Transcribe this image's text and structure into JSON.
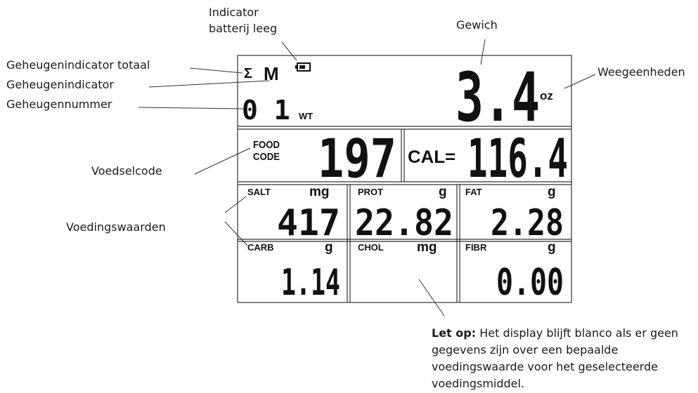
{
  "callouts": {
    "battery_indicator_line1": "Indicator",
    "battery_indicator_line2": "batterij leeg",
    "weight": "Gewich",
    "memory_total": "Geheugenindicator totaal",
    "memory_indicator": "Geheugenindicator",
    "memory_number": "Geheugennummer",
    "weight_units": "Weegeenheden",
    "food_code": "Voedselcode",
    "nutrition_values": "Voedingswaarden"
  },
  "display": {
    "sigma": "Σ",
    "memory_symbol": "M",
    "memory_number": "0 1",
    "wt_label": "WT",
    "weight_value": "3.4",
    "weight_unit": "oz",
    "food_label_line1": "FOOD",
    "food_label_line2": "CODE",
    "food_code_value": "197",
    "cal_label": "CAL=",
    "cal_value": "116.4",
    "cells": [
      {
        "name": "SALT",
        "unit": "mg",
        "value": "417"
      },
      {
        "name": "PROT",
        "unit": "g",
        "value": "22.82"
      },
      {
        "name": "FAT",
        "unit": "g",
        "value": "2.28"
      },
      {
        "name": "CARB",
        "unit": "g",
        "value": "1.14"
      },
      {
        "name": "CHOL",
        "unit": "mg",
        "value": ""
      },
      {
        "name": "FIBR",
        "unit": "g",
        "value": "0.00"
      }
    ]
  },
  "note": {
    "bold": "Let op:",
    "text": "Het display blijft blanco als er geen gegevens zijn over een bepaalde voedingswaarde voor het geselecteerde voedingsmiddel."
  }
}
